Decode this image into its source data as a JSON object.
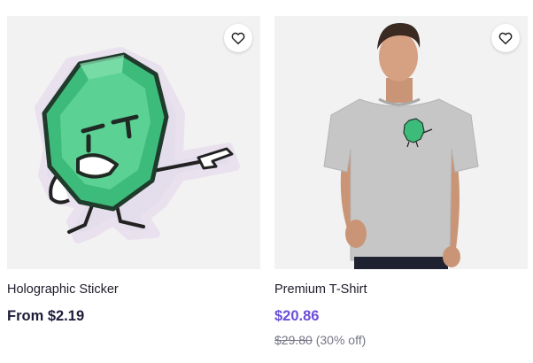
{
  "products": [
    {
      "title": "Holographic Sticker",
      "price": "From $2.19",
      "image_subject": "green gem character pointing sticker"
    },
    {
      "title": "Premium T-Shirt",
      "price": "$20.86",
      "original_price": "$29.80",
      "discount": "(30% off)",
      "image_subject": "model wearing grey t-shirt with green gem print"
    }
  ],
  "icons": {
    "favorite": "heart-outline-icon"
  },
  "colors": {
    "sale_price": "#6b4fd8",
    "text": "#1d1d2b",
    "muted": "#767687",
    "thumb_bg": "#f2f2f2"
  }
}
